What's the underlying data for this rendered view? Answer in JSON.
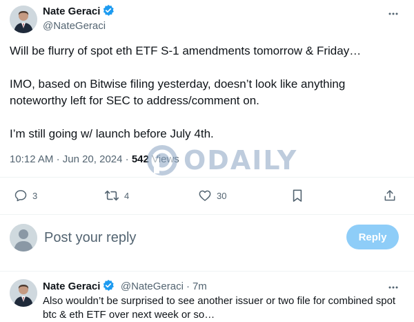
{
  "tweet": {
    "author": {
      "name": "Nate Geraci",
      "handle": "@NateGeraci",
      "verified": true
    },
    "paragraphs": [
      "Will be flurry of spot eth ETF S-1 amendments tomorrow & Friday…",
      "IMO, based on Bitwise filing yesterday, doesn’t look like anything noteworthy left for SEC to address/comment on.",
      "I’m still going w/ launch before July 4th."
    ],
    "time": "10:12 AM",
    "date": "Jun 20, 2024",
    "separator": "·",
    "views_count": "542",
    "views_label": "Views",
    "actions": {
      "replies": "3",
      "reposts": "4",
      "likes": "30"
    }
  },
  "watermark": {
    "text": "ODAILY"
  },
  "reply_composer": {
    "placeholder": "Post your reply",
    "button_label": "Reply"
  },
  "reply": {
    "author": {
      "name": "Nate Geraci",
      "handle": "@NateGeraci",
      "verified": true
    },
    "separator": "·",
    "time_ago": "7m",
    "text": "Also wouldn’t be surprised to see another issuer or two file for combined spot btc & eth ETF over next week or so…"
  },
  "colors": {
    "verified_blue": "#1d9bf0",
    "reply_button_disabled": "#8ecdf8",
    "secondary_text": "#536471"
  }
}
